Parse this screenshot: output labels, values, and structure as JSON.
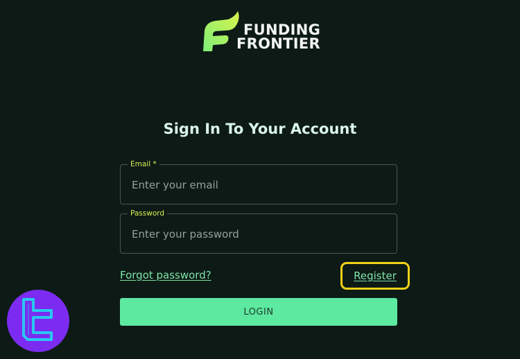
{
  "brand": {
    "line1": "FUNDING",
    "line2": "FRONTIER",
    "logo_icon": "f-flame-icon"
  },
  "form": {
    "title": "Sign In To Your Account",
    "email": {
      "label": "Email *",
      "placeholder": "Enter your email",
      "value": ""
    },
    "password": {
      "label": "Password",
      "placeholder": "Enter your password",
      "value": ""
    },
    "forgot_label": "Forgot password?",
    "register_label": "Register",
    "login_label": "LOGIN"
  },
  "watermark": {
    "icon": "tc-badge-icon"
  },
  "colors": {
    "background": "#0d1a16",
    "accent": "#5de9a0",
    "label": "#d8f050",
    "highlight": "#f2d117",
    "badge": "#7b2cf0"
  }
}
